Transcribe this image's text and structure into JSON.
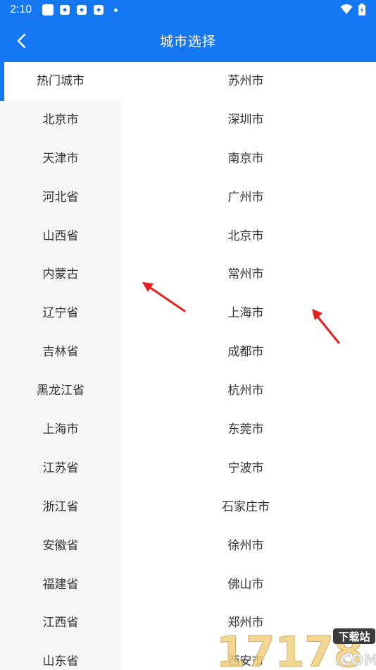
{
  "status_bar": {
    "time": "2:10"
  },
  "header": {
    "title": "城市选择"
  },
  "provinces": [
    "热门城市",
    "北京市",
    "天津市",
    "河北省",
    "山西省",
    "内蒙古",
    "辽宁省",
    "吉林省",
    "黑龙江省",
    "上海市",
    "江苏省",
    "浙江省",
    "安徽省",
    "福建省",
    "江西省",
    "山东省"
  ],
  "active_province_index": 0,
  "cities": [
    "苏州市",
    "深圳市",
    "南京市",
    "广州市",
    "北京市",
    "常州市",
    "上海市",
    "成都市",
    "杭州市",
    "东莞市",
    "宁波市",
    "石家庄市",
    "徐州市",
    "佛山市",
    "郑州市",
    "西安市"
  ],
  "watermark": {
    "text": "17178",
    "badge": "下载站",
    "suffix": ".COM"
  },
  "colors": {
    "accent": "#1677f2",
    "sidebar_bg": "#f5f6f8",
    "annotation_arrow": "#e3201b"
  }
}
